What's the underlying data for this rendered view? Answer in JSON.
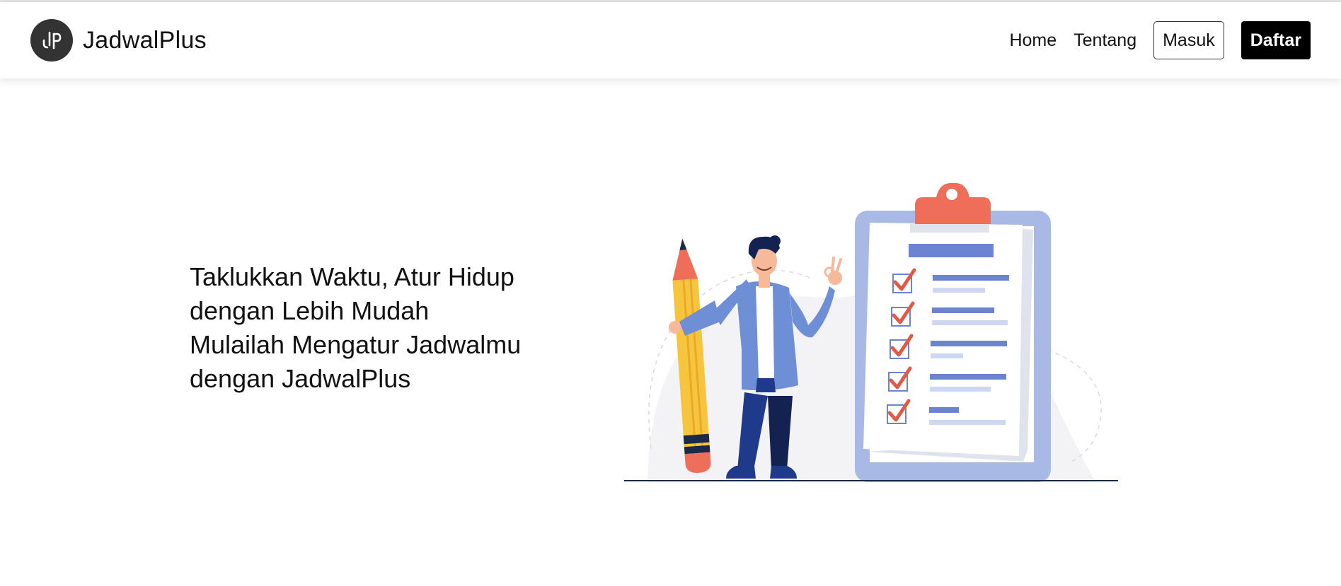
{
  "header": {
    "brand_name": "JadwalPlus",
    "logo_icon": "jp-monogram-icon",
    "nav": {
      "home_label": "Home",
      "about_label": "Tentang",
      "login_label": "Masuk",
      "register_label": "Daftar"
    }
  },
  "hero": {
    "line1": "Taklukkan Waktu, Atur Hidup",
    "line2": "dengan Lebih Mudah",
    "line3": "Mulailah Mengatur Jadwalmu",
    "line4": "dengan JadwalPlus"
  },
  "illustration": {
    "subject": "checklist-clipboard-with-person-and-pencil",
    "colors": {
      "clipboard_frame": "#a9b9e6",
      "clip": "#ee6e5a",
      "check": "#e25a45",
      "line_dark": "#6b84cf",
      "line_light": "#cdd7f3",
      "pencil": "#f7c53d",
      "jacket": "#6e8ed6",
      "pants": "#1f3a8a",
      "ground": "#1b2a4a"
    }
  }
}
